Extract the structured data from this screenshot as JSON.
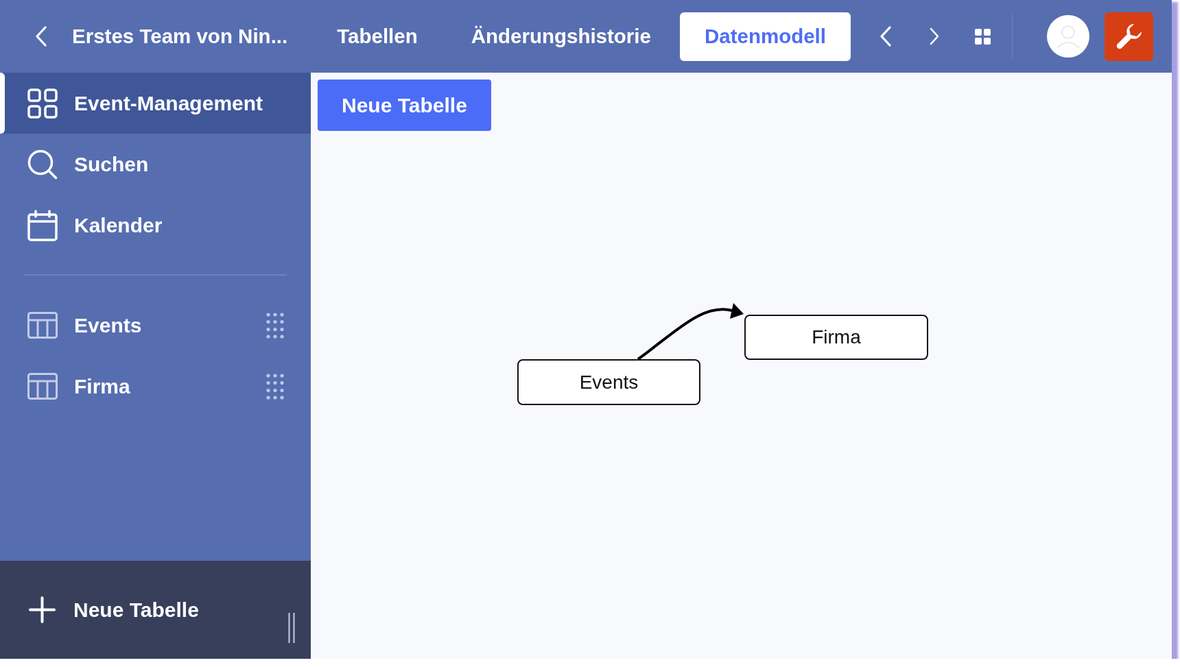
{
  "topbar": {
    "title": "Erstes Team von Nin...",
    "tabs": [
      {
        "label": "Tabellen",
        "selected": false
      },
      {
        "label": "Änderungshistorie",
        "selected": false
      },
      {
        "label": "Datenmodell",
        "selected": true
      }
    ]
  },
  "sidebar": {
    "items": [
      {
        "label": "Event-Management",
        "kind": "app",
        "selected": true
      },
      {
        "label": "Suchen",
        "kind": "search",
        "selected": false
      },
      {
        "label": "Kalender",
        "kind": "calendar",
        "selected": false
      }
    ],
    "tables": [
      {
        "label": "Events",
        "selected": false
      },
      {
        "label": "Firma",
        "selected": false
      }
    ],
    "footer_button": "Neue Tabelle"
  },
  "main": {
    "new_table_button": "Neue Tabelle",
    "diagram": {
      "nodes": [
        {
          "label": "Events"
        },
        {
          "label": "Firma"
        }
      ]
    }
  }
}
